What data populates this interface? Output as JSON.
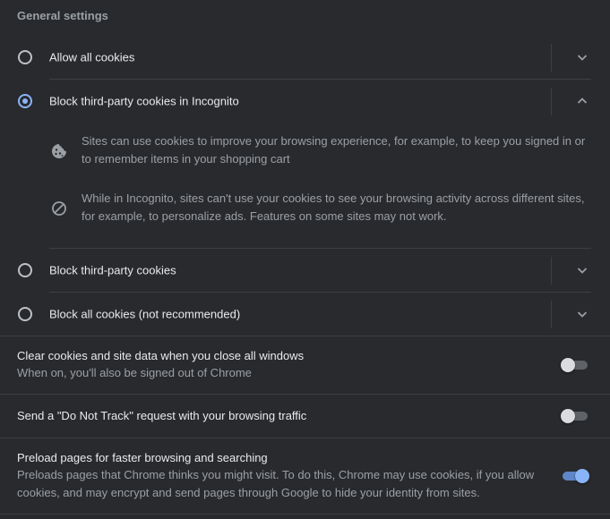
{
  "general_settings": {
    "title": "General settings",
    "options": [
      {
        "label": "Allow all cookies",
        "selected": false,
        "expanded": false
      },
      {
        "label": "Block third-party cookies in Incognito",
        "selected": true,
        "expanded": true
      },
      {
        "label": "Block third-party cookies",
        "selected": false,
        "expanded": false
      },
      {
        "label": "Block all cookies (not recommended)",
        "selected": false,
        "expanded": false
      }
    ],
    "incognito_details": [
      {
        "icon": "cookie-icon",
        "text": "Sites can use cookies to improve your browsing experience, for example, to keep you signed in or to remember items in your shopping cart"
      },
      {
        "icon": "block-icon",
        "text": "While in Incognito, sites can't use your cookies to see your browsing activity across different sites, for example, to personalize ads. Features on some sites may not work."
      }
    ]
  },
  "toggles": [
    {
      "title": "Clear cookies and site data when you close all windows",
      "subtitle": "When on, you'll also be signed out of Chrome",
      "on": false
    },
    {
      "title": "Send a \"Do Not Track\" request with your browsing traffic",
      "subtitle": "",
      "on": false
    },
    {
      "title": "Preload pages for faster browsing and searching",
      "subtitle": "Preloads pages that Chrome thinks you might visit. To do this, Chrome may use cookies, if you allow cookies, and may encrypt and send pages through Google to hide your identity from sites.",
      "on": true
    }
  ],
  "colors": {
    "background": "#292a2d",
    "text_primary": "#e8eaed",
    "text_secondary": "#9aa0a6",
    "accent": "#8ab4f8",
    "divider": "#3c4043"
  }
}
